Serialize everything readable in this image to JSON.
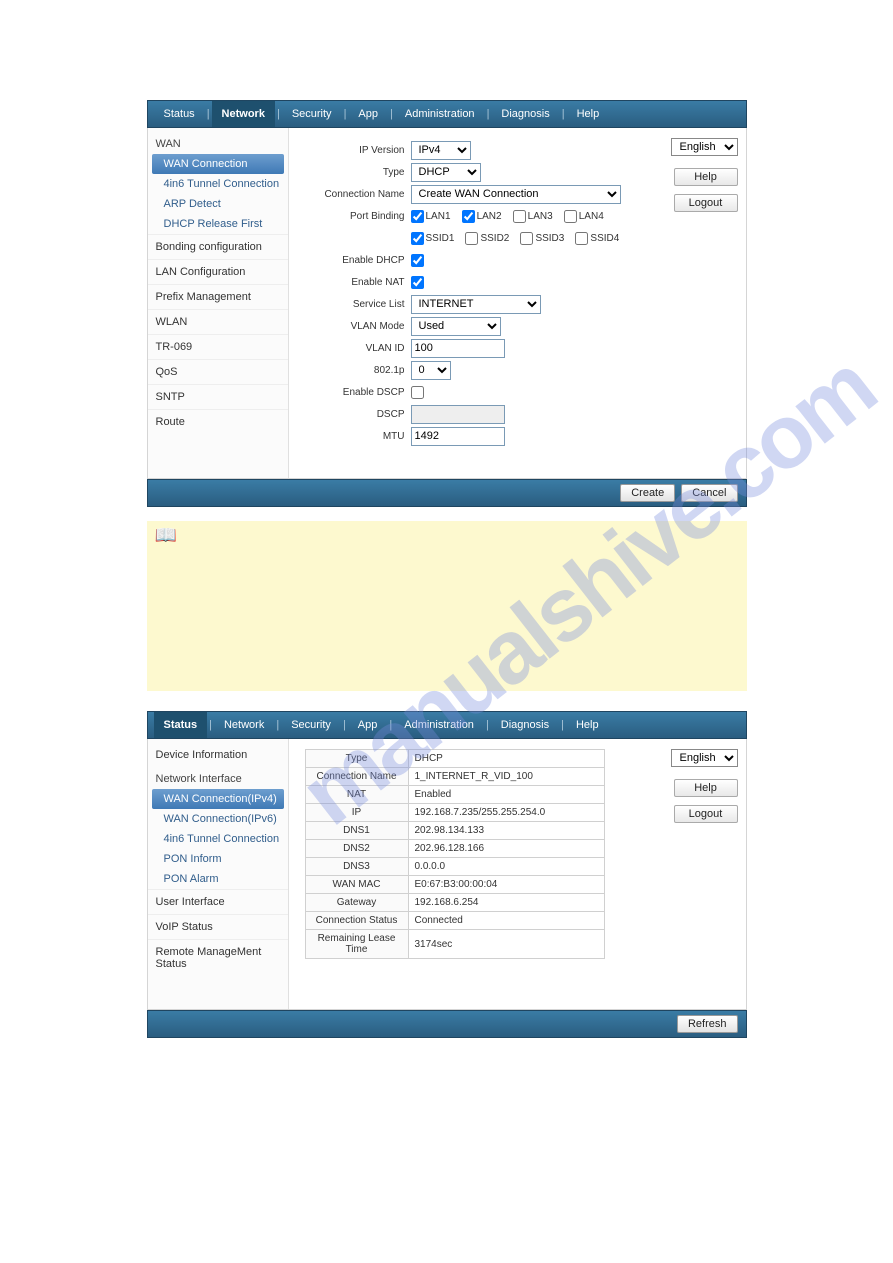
{
  "watermark": "manualshive.com",
  "nav": {
    "tabs": [
      "Status",
      "Network",
      "Security",
      "App",
      "Administration",
      "Diagnosis",
      "Help"
    ]
  },
  "screen1": {
    "active_tab_index": 1,
    "sidebar": {
      "wan_head": "WAN",
      "wan_items": [
        "WAN Connection",
        "4in6 Tunnel Connection",
        "ARP Detect",
        "DHCP Release First"
      ],
      "wan_selected": 0,
      "items": [
        "Bonding configuration",
        "LAN Configuration",
        "Prefix Management",
        "WLAN",
        "TR-069",
        "QoS",
        "SNTP",
        "Route"
      ]
    },
    "form": {
      "ip_version": {
        "label": "IP Version",
        "value": "IPv4"
      },
      "type": {
        "label": "Type",
        "value": "DHCP"
      },
      "connection_name": {
        "label": "Connection Name",
        "value": "Create WAN Connection"
      },
      "port_binding": {
        "label": "Port Binding",
        "ports": [
          {
            "label": "LAN1",
            "checked": true
          },
          {
            "label": "LAN2",
            "checked": true
          },
          {
            "label": "LAN3",
            "checked": false
          },
          {
            "label": "LAN4",
            "checked": false
          },
          {
            "label": "SSID1",
            "checked": true
          },
          {
            "label": "SSID2",
            "checked": false
          },
          {
            "label": "SSID3",
            "checked": false
          },
          {
            "label": "SSID4",
            "checked": false
          }
        ]
      },
      "enable_dhcp": {
        "label": "Enable DHCP",
        "checked": true
      },
      "enable_nat": {
        "label": "Enable NAT",
        "checked": true
      },
      "service_list": {
        "label": "Service List",
        "value": "INTERNET"
      },
      "vlan_mode": {
        "label": "VLAN Mode",
        "value": "Used"
      },
      "vlan_id": {
        "label": "VLAN ID",
        "value": "100"
      },
      "p802": {
        "label": "802.1p",
        "value": "0"
      },
      "enable_dscp": {
        "label": "Enable DSCP",
        "checked": false
      },
      "dscp": {
        "label": "DSCP",
        "value": ""
      },
      "mtu": {
        "label": "MTU",
        "value": "1492"
      }
    },
    "right": {
      "lang": "English",
      "help": "Help",
      "logout": "Logout"
    },
    "footer": {
      "create": "Create",
      "cancel": "Cancel"
    }
  },
  "screen2": {
    "active_tab_index": 0,
    "sidebar": {
      "heads": [
        "Device Information",
        "Network Interface",
        "User Interface",
        "VoIP Status",
        "Remote ManageMent Status"
      ],
      "net_items": [
        "WAN Connection(IPv4)",
        "WAN Connection(IPv6)",
        "4in6 Tunnel Connection",
        "PON Inform",
        "PON Alarm"
      ],
      "net_selected": 0
    },
    "table": [
      {
        "k": "Type",
        "v": "DHCP"
      },
      {
        "k": "Connection Name",
        "v": "1_INTERNET_R_VID_100"
      },
      {
        "k": "NAT",
        "v": "Enabled"
      },
      {
        "k": "IP",
        "v": "192.168.7.235/255.255.254.0"
      },
      {
        "k": "DNS1",
        "v": "202.98.134.133"
      },
      {
        "k": "DNS2",
        "v": "202.96.128.166"
      },
      {
        "k": "DNS3",
        "v": "0.0.0.0"
      },
      {
        "k": "WAN MAC",
        "v": "E0:67:B3:00:00:04"
      },
      {
        "k": "Gateway",
        "v": "192.168.6.254"
      },
      {
        "k": "Connection Status",
        "v": "Connected"
      },
      {
        "k": "Remaining Lease Time",
        "v": "3174sec"
      }
    ],
    "right": {
      "lang": "English",
      "help": "Help",
      "logout": "Logout"
    },
    "footer": {
      "refresh": "Refresh"
    }
  }
}
